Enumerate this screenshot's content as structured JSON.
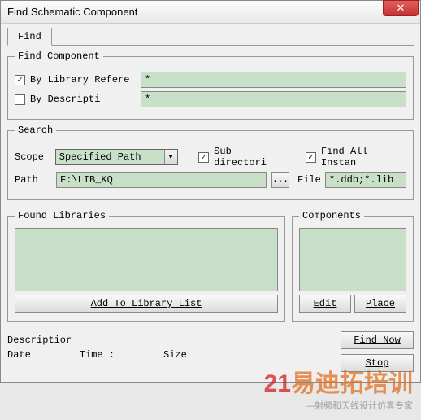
{
  "title": "Find Schematic Component",
  "tabs": {
    "find": "Find"
  },
  "findComponent": {
    "legend": "Find Component",
    "byLibRef_checked": true,
    "byLibRef_label": "By Library Refere",
    "byLibRef_value": "*",
    "byDesc_checked": false,
    "byDesc_label": "By Descripti",
    "byDesc_value": "*"
  },
  "search": {
    "legend": "Search",
    "scope_label": "Scope",
    "scope_value": "Specified Path",
    "subdir_checked": true,
    "subdir_label": "Sub directori",
    "findAll_checked": true,
    "findAll_label": "Find All Instan",
    "path_label": "Path",
    "path_value": "F:\\LIB_KQ",
    "browse_label": "...",
    "file_label": "File",
    "file_value": "*.ddb;*.lib"
  },
  "found": {
    "legend": "Found Libraries",
    "addBtn": "Add To Library List"
  },
  "components": {
    "legend": "Components",
    "editBtn": "Edit",
    "placeBtn": "Place"
  },
  "bottom": {
    "description": "Descriptior",
    "date": "Date",
    "time": "Time :",
    "size": "Size",
    "findNow": "Find Now",
    "stop": "Stop"
  },
  "watermark": {
    "num": "21",
    "text": "易迪拓培训",
    "sub": "—射频和天线设计仿真专家"
  }
}
